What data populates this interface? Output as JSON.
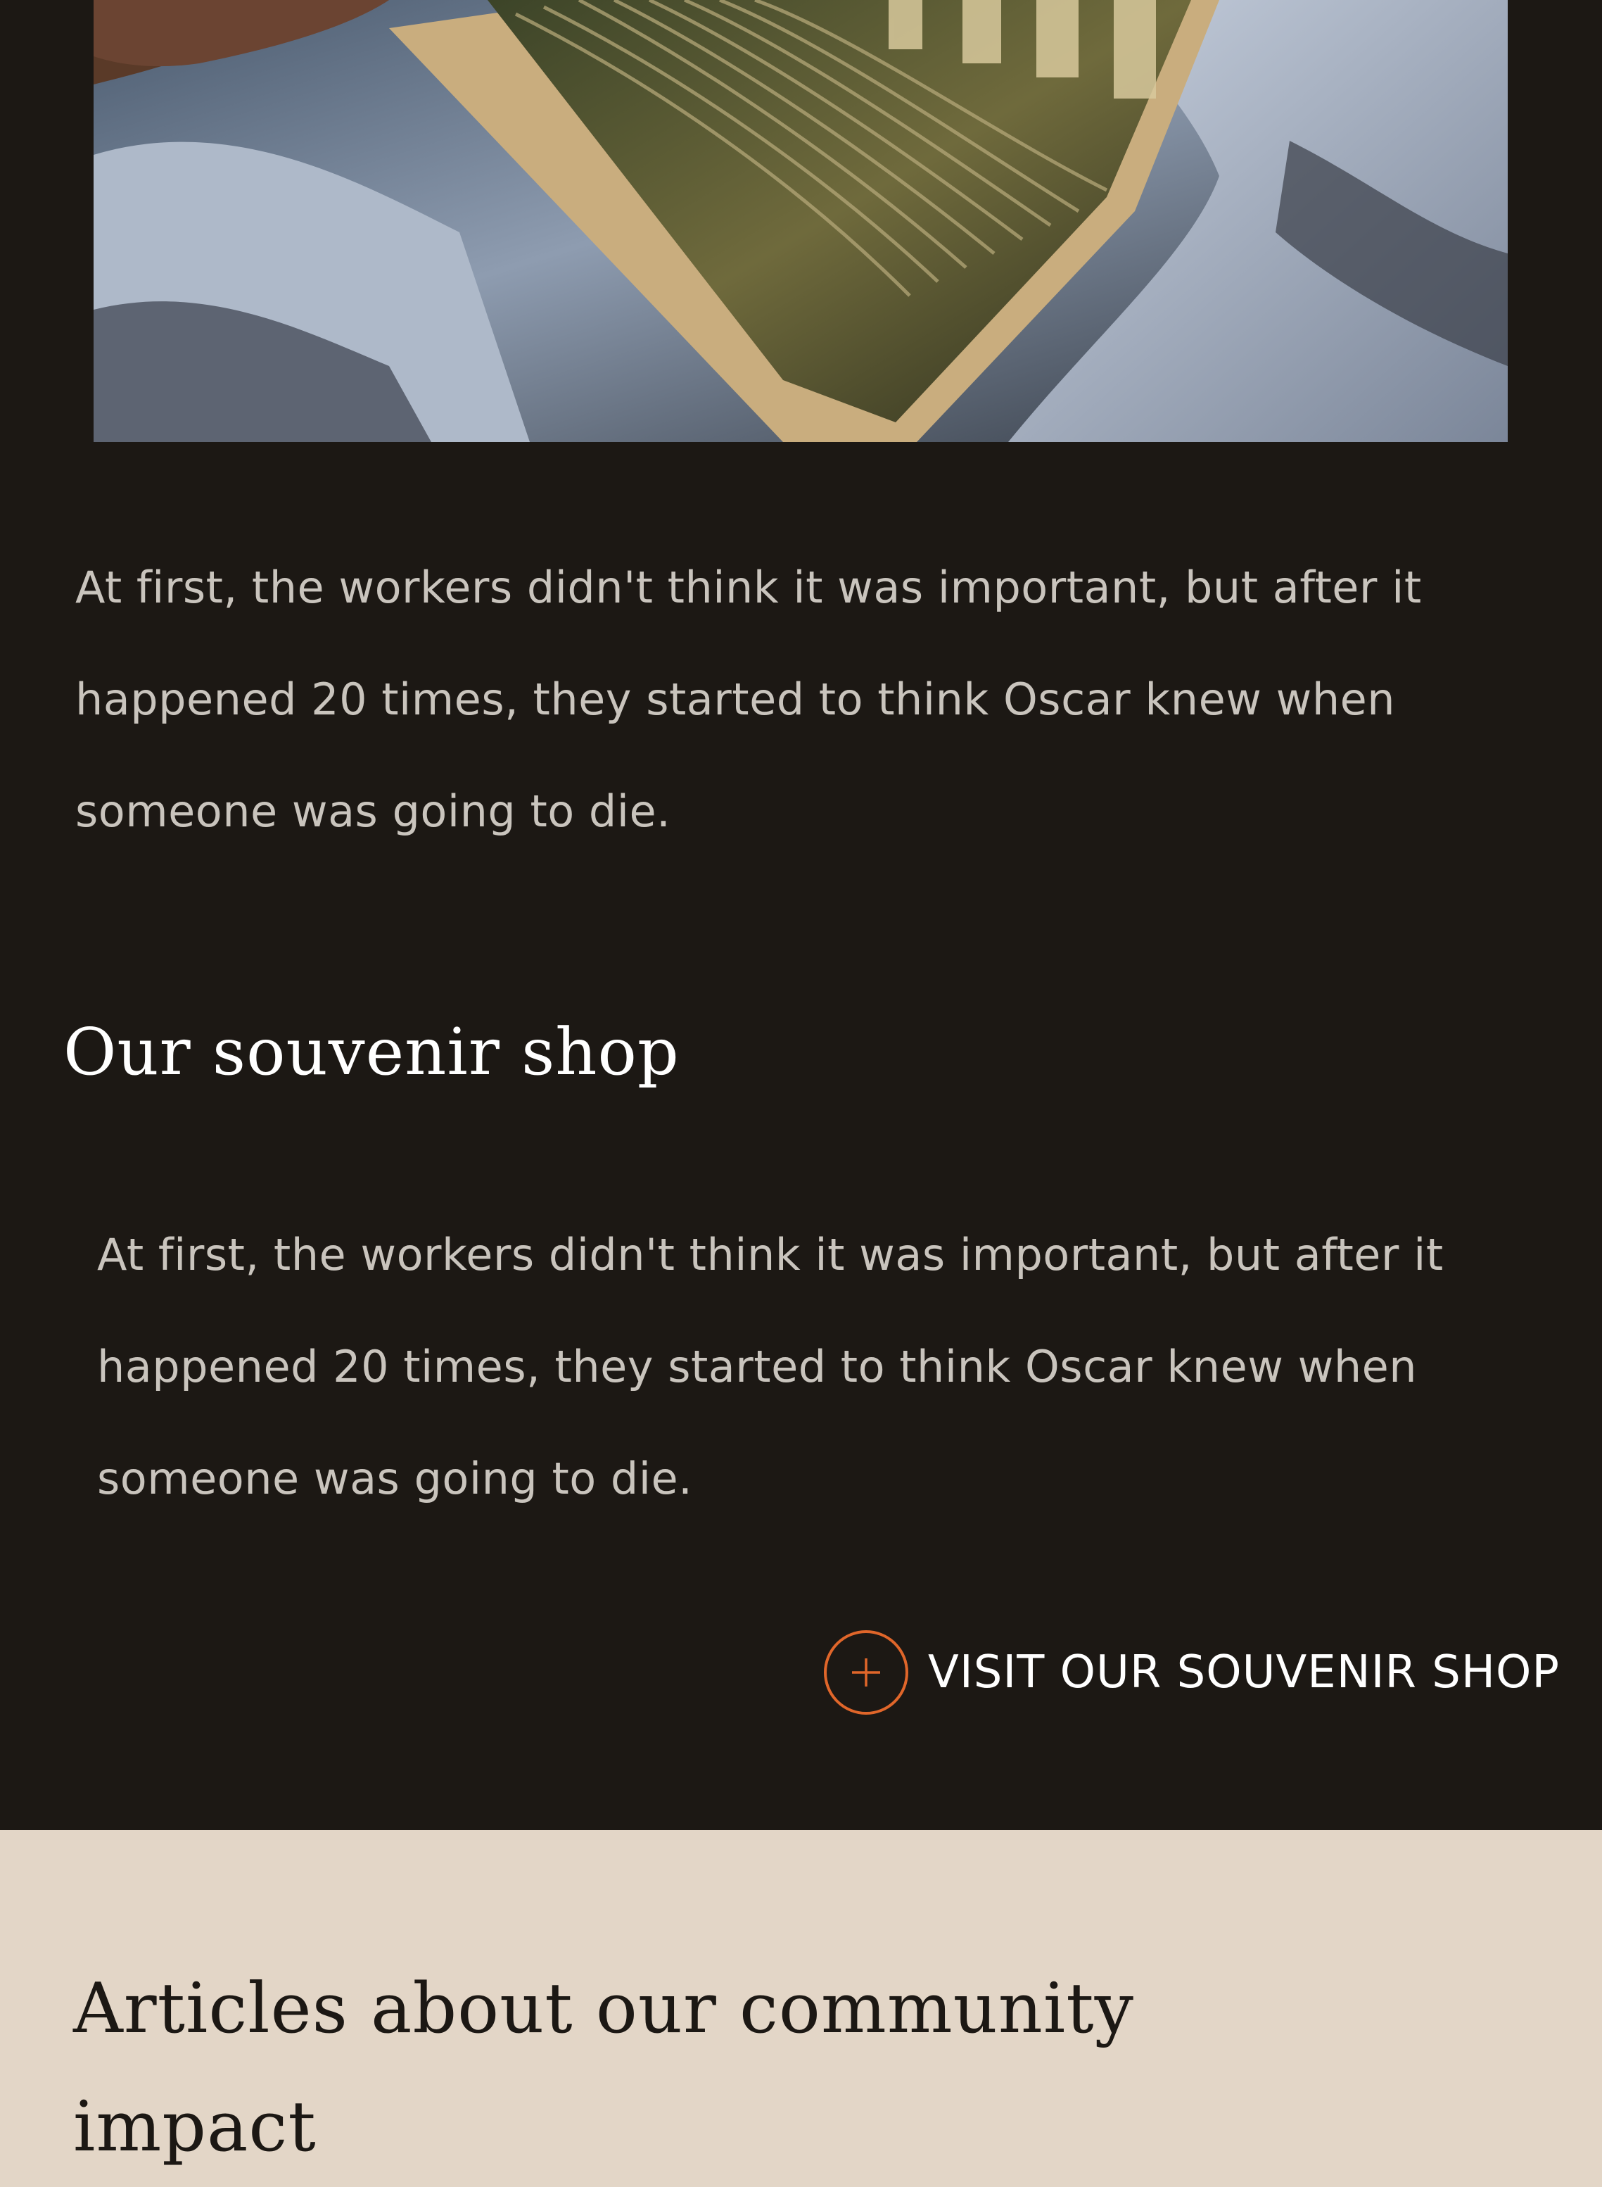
{
  "story": {
    "paragraph": "At first, the workers didn't think it was important, but after it happened 20 times, they started to think Oscar knew when someone was going to die."
  },
  "souvenir_shop": {
    "title": "Our souvenir shop",
    "paragraph": "At first, the workers didn't think it was important, but after it happened 20 times, they started to think Oscar knew when someone was going to die.",
    "link_label": "VISIT OUR SOUVENIR SHOP",
    "link_icon": "plus-circle-icon"
  },
  "articles": {
    "title": "Articles about our community impact"
  },
  "colors": {
    "dark_background": "#1c1814",
    "light_background": "#e3d6c7",
    "accent": "#e0662a",
    "body_text": "#c9c4bd",
    "heading_text": "#ffffff"
  }
}
